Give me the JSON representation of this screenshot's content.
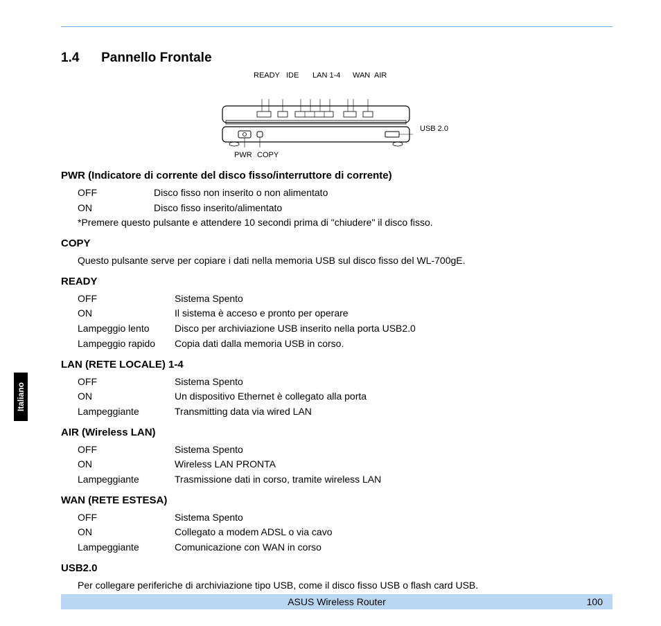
{
  "side_tab": "Italiano",
  "section_number": "1.4",
  "section_title": "Pannello Frontale",
  "figure_labels": {
    "ready": "READY",
    "ide": "IDE",
    "lan": "LAN 1-4",
    "wan": "WAN",
    "air": "AIR",
    "usb": "USB 2.0",
    "pwr": "PWR",
    "copy": "COPY"
  },
  "pwr": {
    "heading": "PWR (Indicatore di corrente del disco fisso/interruttore di corrente)",
    "rows": [
      {
        "term": "OFF",
        "desc": "Disco fisso non inserito o non alimentato"
      },
      {
        "term": "ON",
        "desc": "Disco fisso inserito/alimentato"
      }
    ],
    "note": "*Premere questo pulsante e attendere 10 secondi prima di \"chiudere\" il disco fisso."
  },
  "copy": {
    "heading": "COPY",
    "para": "Questo pulsante serve per copiare i dati nella memoria USB sul disco fisso del WL-700gE."
  },
  "ready": {
    "heading": "READY",
    "rows": [
      {
        "term": "OFF",
        "desc": "Sistema Spento"
      },
      {
        "term": "ON",
        "desc": "Il sistema è acceso e pronto per operare"
      },
      {
        "term": "Lampeggio lento",
        "desc": "Disco per archiviazione USB inserito nella porta USB2.0"
      },
      {
        "term": "Lampeggio rapido",
        "desc": "Copia dati dalla memoria USB in corso."
      }
    ]
  },
  "lan": {
    "heading": "LAN (RETE LOCALE) 1-4",
    "rows": [
      {
        "term": "OFF",
        "desc": "Sistema Spento"
      },
      {
        "term": "ON",
        "desc": "Un dispositivo Ethernet è collegato alla porta"
      },
      {
        "term": "Lampeggiante",
        "desc": "Transmitting data via wired LAN"
      }
    ]
  },
  "air": {
    "heading": "AIR (Wireless LAN)",
    "rows": [
      {
        "term": "OFF",
        "desc": "Sistema Spento"
      },
      {
        "term": "ON",
        "desc": "Wireless LAN PRONTA"
      },
      {
        "term": "Lampeggiante",
        "desc": "Trasmissione dati in corso, tramite wireless LAN"
      }
    ]
  },
  "wan": {
    "heading": "WAN (RETE ESTESA)",
    "rows": [
      {
        "term": "OFF",
        "desc": "Sistema Spento"
      },
      {
        "term": "ON",
        "desc": "Collegato a modem ADSL o via cavo"
      },
      {
        "term": "Lampeggiante",
        "desc": "Comunicazione con WAN in corso"
      }
    ]
  },
  "usb": {
    "heading": "USB2.0",
    "para": "Per collegare periferiche di archiviazione tipo USB, come il disco fisso USB o flash card USB."
  },
  "footer": {
    "title": "ASUS Wireless Router",
    "page": "100"
  }
}
